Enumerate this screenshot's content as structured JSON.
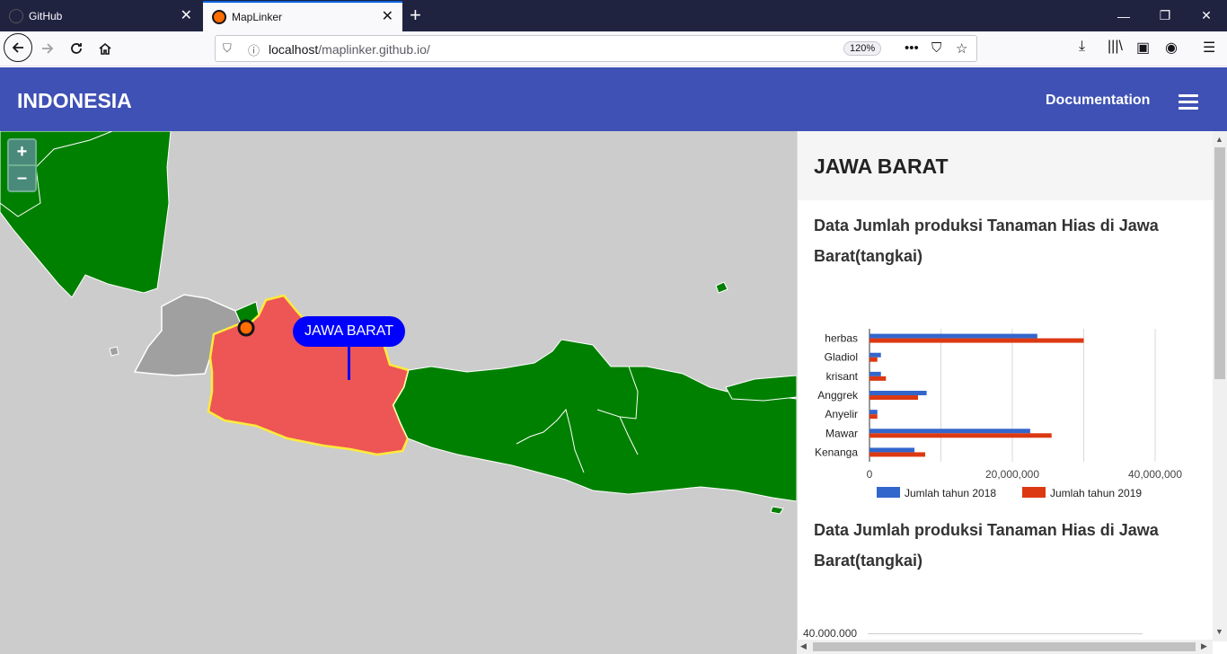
{
  "browser": {
    "tabs": [
      {
        "label": "GitHub",
        "active": false
      },
      {
        "label": "MapLinker",
        "active": true
      }
    ],
    "url_host": "localhost",
    "url_path": "/maplinker.github.io/",
    "zoom": "120%"
  },
  "app": {
    "title": "INDONESIA",
    "nav_link": "Documentation"
  },
  "map": {
    "zoom_in": "+",
    "zoom_out": "–",
    "tooltip": "JAWA BARAT",
    "colors": {
      "sea": "#cccccc",
      "land": "#008000",
      "selected": "#ee5555",
      "selected_border": "#ffeb3b",
      "other": "#a0a0a0"
    }
  },
  "panel": {
    "title": "JAWA BARAT",
    "section1_title": "Data Jumlah produksi Tanaman Hias di Jawa Barat(tangkai)",
    "section2_title": "Data Jumlah produksi Tanaman Hias di Jawa Barat(tangkai)",
    "section2_axis_top": "40.000.000"
  },
  "chart_data": {
    "type": "bar",
    "orientation": "horizontal",
    "categories": [
      "herbas",
      "Gladiol",
      "krisant",
      "Anggrek",
      "Anyelir",
      "Mawar",
      "Kenanga"
    ],
    "series": [
      {
        "name": "Jumlah tahun 2018",
        "color": "#3366cc",
        "values": [
          23500000,
          1600000,
          1600000,
          8000000,
          1100000,
          22500000,
          6300000
        ]
      },
      {
        "name": "Jumlah tahun 2019",
        "color": "#dc3912",
        "values": [
          30000000,
          1100000,
          2300000,
          6800000,
          1100000,
          25500000,
          7800000
        ]
      }
    ],
    "xlim": [
      0,
      40000000
    ],
    "xticks": [
      "0",
      "20,000,000",
      "40,000,000"
    ],
    "legend": "bottom"
  }
}
